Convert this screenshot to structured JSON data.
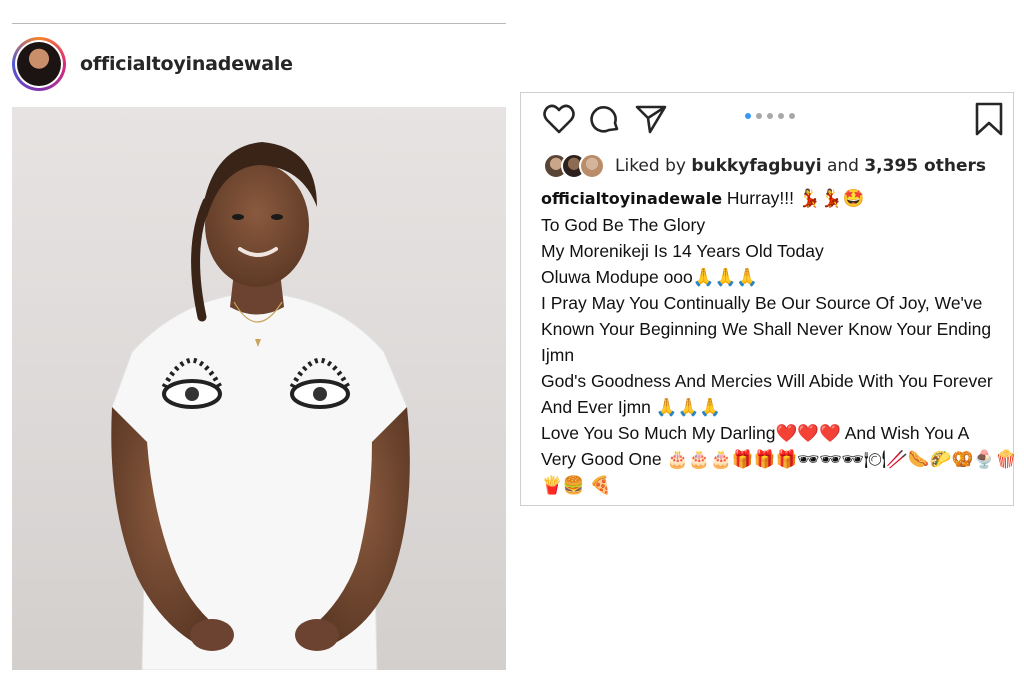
{
  "post": {
    "username": "officialtoyinadewale",
    "avatar_icon": "profile-avatar",
    "photo_icon": "portrait-photo"
  },
  "actions": {
    "like_icon": "heart-icon",
    "comment_icon": "comment-icon",
    "share_icon": "send-icon",
    "save_icon": "bookmark-icon",
    "carousel": {
      "total": 5,
      "active_index": 0
    }
  },
  "likes": {
    "prefix": "Liked by",
    "user": "bukkyfagbuyi",
    "joiner": "and",
    "count": "3,395 others"
  },
  "caption": {
    "username": "officialtoyinadewale",
    "lines": [
      "Hurray!!! 💃💃🤩",
      "To God Be The Glory",
      "My Morenikeji Is 14 Years Old Today",
      "Oluwa Modupe ooo🙏🙏🙏",
      "I Pray May You Continually Be Our Source Of Joy, We've",
      "Known Your Beginning We Shall Never Know Your Ending",
      "Ijmn",
      "God's Goodness And Mercies Will Abide With You Forever",
      "And Ever Ijmn 🙏🙏🙏",
      "Love You So Much My Darling❤️❤️❤️ And Wish You A",
      "Very Good One 🎂🎂🎂🎁🎁🎁🕶🕶🕶🍽🥢🌭🌮🥨🍨🍿",
      "🍟🍔 🍕"
    ]
  },
  "colors": {
    "carousel_active": "#3897f0",
    "carousel_inactive": "#a8a8a8",
    "text": "#262626",
    "divider": "#cfcfcf"
  }
}
